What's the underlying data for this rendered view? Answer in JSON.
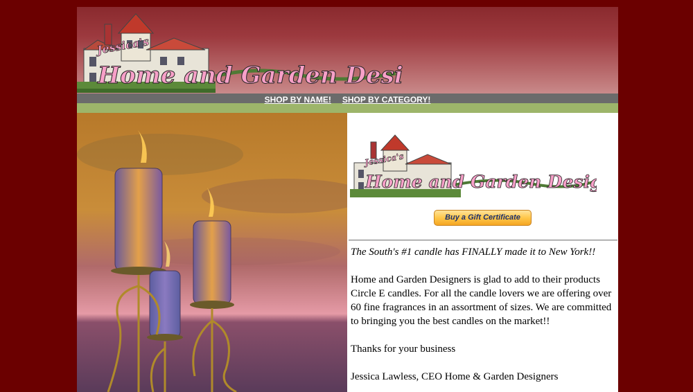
{
  "header": {
    "logo_script": "Jessica's",
    "logo_title": "Home and Garden Designers"
  },
  "nav": {
    "shop_by_name": "SHOP BY NAME!",
    "shop_by_category": "SHOP BY CATEGORY!"
  },
  "content": {
    "logo_script": "Jessica's",
    "logo_title": "Home and Garden Designers",
    "gift_button": "Buy a Gift Certificate",
    "tagline": "The South's #1 candle has FINALLY made it to New York!!",
    "paragraph": "Home and Garden Designers is glad to add to their products Circle E candles.  For all the candle lovers we are offering over 60 fine fragrances in an assortment of sizes.  We are committed to bringing you the best candles on the market!!",
    "thanks": "Thanks for your business",
    "signature": "Jessica Lawless, CEO Home & Garden Designers"
  },
  "colors": {
    "outer_background": "#6b0000",
    "header_top": "#8a2a2e",
    "nav_gray": "#6b6b6b",
    "nav_green": "#9db56a",
    "logo_pink": "#f7a0c8"
  }
}
